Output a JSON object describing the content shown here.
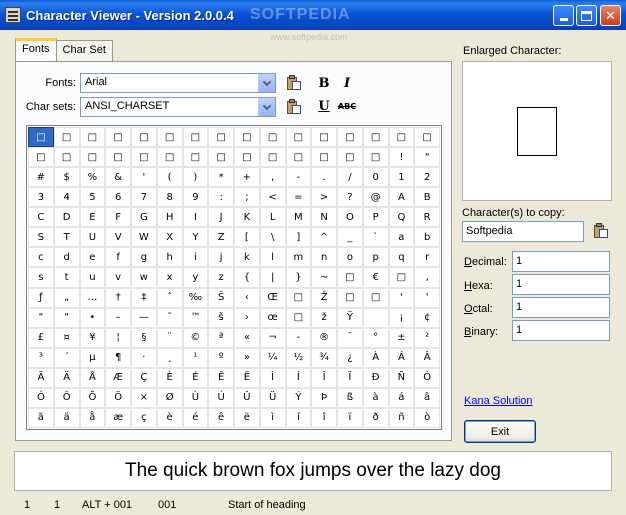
{
  "window": {
    "title": "Character Viewer - Version 2.0.0.4"
  },
  "watermark": {
    "text": "SOFTPEDIA",
    "sub": "www.softpedia.com"
  },
  "tabs": [
    {
      "label": "Fonts"
    },
    {
      "label": "Char Set"
    }
  ],
  "fonts": {
    "label": "Fonts:",
    "value": "Arial"
  },
  "charsets": {
    "label": "Char sets:",
    "value": "ANSI_CHARSET"
  },
  "format": {
    "bold": "B",
    "italic": "I",
    "underline": "U",
    "strike": "ABC"
  },
  "grid": {
    "rows": [
      [
        "□",
        "□",
        "□",
        "□",
        "□",
        "□",
        "□",
        "□",
        "□",
        "□",
        "□",
        "□",
        "□",
        "□",
        "□",
        "□"
      ],
      [
        "□",
        "□",
        "□",
        "□",
        "□",
        "□",
        "□",
        "□",
        "□",
        "□",
        "□",
        "□",
        "□",
        "□",
        "!",
        "\""
      ],
      [
        "#",
        "$",
        "%",
        "&",
        "'",
        "(",
        ")",
        "*",
        "+",
        ",",
        "-",
        ".",
        "/",
        "0",
        "1",
        "2"
      ],
      [
        "3",
        "4",
        "5",
        "6",
        "7",
        "8",
        "9",
        ":",
        ";",
        "<",
        "=",
        ">",
        "?",
        "@",
        "A",
        "B"
      ],
      [
        "C",
        "D",
        "E",
        "F",
        "G",
        "H",
        "I",
        "J",
        "K",
        "L",
        "M",
        "N",
        "O",
        "P",
        "Q",
        "R"
      ],
      [
        "S",
        "T",
        "U",
        "V",
        "W",
        "X",
        "Y",
        "Z",
        "[",
        "\\",
        "]",
        "^",
        "_",
        "`",
        "a",
        "b"
      ],
      [
        "c",
        "d",
        "e",
        "f",
        "g",
        "h",
        "i",
        "j",
        "k",
        "l",
        "m",
        "n",
        "o",
        "p",
        "q",
        "r"
      ],
      [
        "s",
        "t",
        "u",
        "v",
        "w",
        "x",
        "y",
        "z",
        "{",
        "|",
        "}",
        "~",
        "□",
        "€",
        "□",
        "‚"
      ],
      [
        "ƒ",
        "„",
        "…",
        "†",
        "‡",
        "ˆ",
        "‰",
        "Š",
        "‹",
        "Œ",
        "□",
        "Ž",
        "□",
        "□",
        "'",
        "'"
      ],
      [
        "\"",
        "\"",
        "•",
        "–",
        "—",
        "˜",
        "™",
        "š",
        "›",
        "œ",
        "□",
        "ž",
        "Ÿ",
        " ",
        "¡",
        "¢"
      ],
      [
        "£",
        "¤",
        "¥",
        "¦",
        "§",
        "¨",
        "©",
        "ª",
        "«",
        "¬",
        "-",
        "®",
        "¯",
        "°",
        "±",
        "²"
      ],
      [
        "³",
        "´",
        "µ",
        "¶",
        "·",
        "¸",
        "¹",
        "º",
        "»",
        "¼",
        "½",
        "¾",
        "¿",
        "À",
        "Á",
        "Â"
      ],
      [
        "Ã",
        "Ä",
        "Å",
        "Æ",
        "Ç",
        "È",
        "É",
        "Ê",
        "Ë",
        "Ì",
        "Í",
        "Î",
        "Ï",
        "Ð",
        "Ñ",
        "Ò"
      ],
      [
        "Ó",
        "Ô",
        "Õ",
        "Ö",
        "×",
        "Ø",
        "Ù",
        "Ú",
        "Û",
        "Ü",
        "Ý",
        "Þ",
        "ß",
        "à",
        "á",
        "â"
      ],
      [
        "ã",
        "ä",
        "å",
        "æ",
        "ç",
        "è",
        "é",
        "ê",
        "ë",
        "ì",
        "í",
        "î",
        "ï",
        "ð",
        "ñ",
        "ò"
      ]
    ]
  },
  "enlarged": {
    "label": "Enlarged Character:"
  },
  "copy": {
    "label": "Character(s) to copy:",
    "value": "Softpedia"
  },
  "decimal": {
    "label": "Decimal:",
    "value": "1"
  },
  "hexa": {
    "label": "Hexa:",
    "value": "1"
  },
  "octal": {
    "label": "Octal:",
    "value": "1"
  },
  "binary": {
    "label": "Binary:",
    "value": "1"
  },
  "link": {
    "label": "Kana Solution"
  },
  "exit": {
    "label": "Exit"
  },
  "preview": {
    "text": "The quick brown fox jumps over the lazy dog"
  },
  "status": {
    "f1": "1",
    "f2": "1",
    "f3": "ALT + 001",
    "f4": "001",
    "f5": "Start of heading"
  }
}
